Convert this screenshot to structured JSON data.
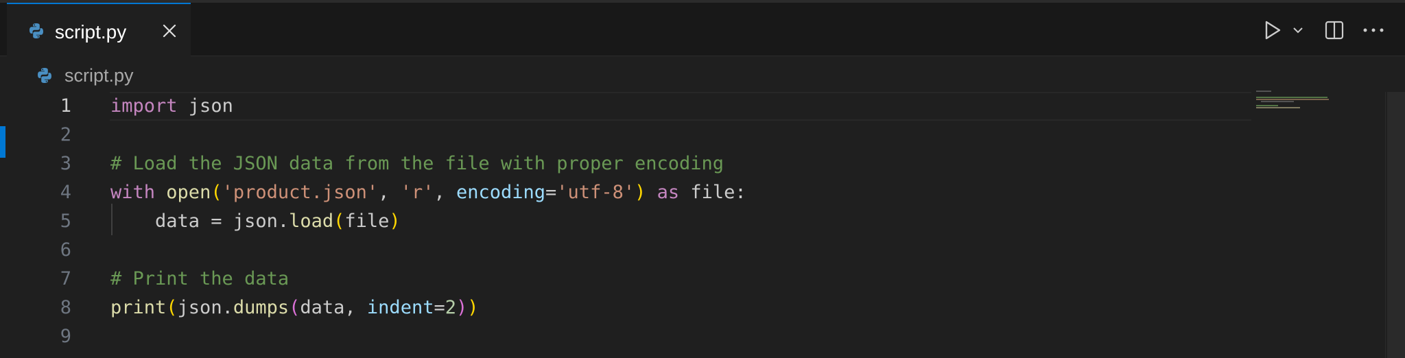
{
  "tab": {
    "label": "script.py",
    "icon": "python-file-icon",
    "close_icon": "close-icon"
  },
  "toolbar": {
    "run_icon": "play-icon",
    "run_menu_icon": "chevron-down-icon",
    "split_icon": "split-editor-icon",
    "more_icon": "more-actions-icon"
  },
  "breadcrumb": {
    "icon": "python-file-icon",
    "label": "script.py"
  },
  "editor": {
    "active_line": 1,
    "lines": [
      {
        "n": "1",
        "text": "import json"
      },
      {
        "n": "2",
        "text": ""
      },
      {
        "n": "3",
        "text": "# Load the JSON data from the file with proper encoding"
      },
      {
        "n": "4",
        "text": "with open('product.json', 'r', encoding='utf-8') as file:"
      },
      {
        "n": "5",
        "text": "    data = json.load(file)"
      },
      {
        "n": "6",
        "text": ""
      },
      {
        "n": "7",
        "text": "# Print the data"
      },
      {
        "n": "8",
        "text": "print(json.dumps(data, indent=2))"
      },
      {
        "n": "9",
        "text": ""
      }
    ]
  },
  "colors": {
    "accent": "#0078d4",
    "keyword": "#c586c0",
    "function": "#dcdcaa",
    "string": "#ce9178",
    "parameter": "#9cdcfe",
    "number": "#b5cea8",
    "comment": "#6a9955",
    "bracket_1": "#ffd700",
    "bracket_2": "#da70d6"
  }
}
